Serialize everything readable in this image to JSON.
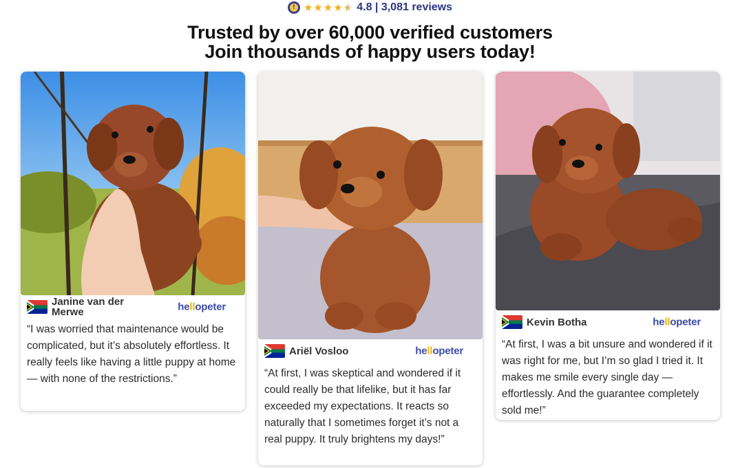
{
  "rating": {
    "score_text": "4.8 | 3,081 reviews",
    "score": 4.8,
    "max": 5
  },
  "headline": {
    "line1": "Trusted by over 60,000 verified customers",
    "line2": "Join thousands of happy users today!"
  },
  "brand": {
    "name_pre": "he",
    "name_mark": "ll",
    "name_post": "opeter"
  },
  "colors": {
    "star": "#f2b01e",
    "brand_blue": "#3a4aa8",
    "brand_yellow": "#f0b400",
    "rating_text": "#2d3480"
  },
  "reviews": [
    {
      "name": "Janine van der Merwe",
      "text": "“I was worried that maintenance would be complicated, but it’s absolutely effortless. It really feels like having a little puppy at home — with none of the restrictions.”",
      "flag": "south-africa-flag-icon"
    },
    {
      "name": "Ariël Vosloo",
      "text": "“At first, I was skeptical and wondered if it could really be that lifelike, but it has far exceeded my expectations. It reacts so naturally that I sometimes forget it’s not a real puppy. It truly brightens my days!”",
      "flag": "south-africa-flag-icon"
    },
    {
      "name": "Kevin Botha",
      "text": "“At first, I was a bit unsure and wondered if it was right for me, but I’m so glad I tried it. It makes me smile every single day — effortlessly. And the guarantee completely sold me!”",
      "flag": "south-africa-flag-icon"
    }
  ]
}
